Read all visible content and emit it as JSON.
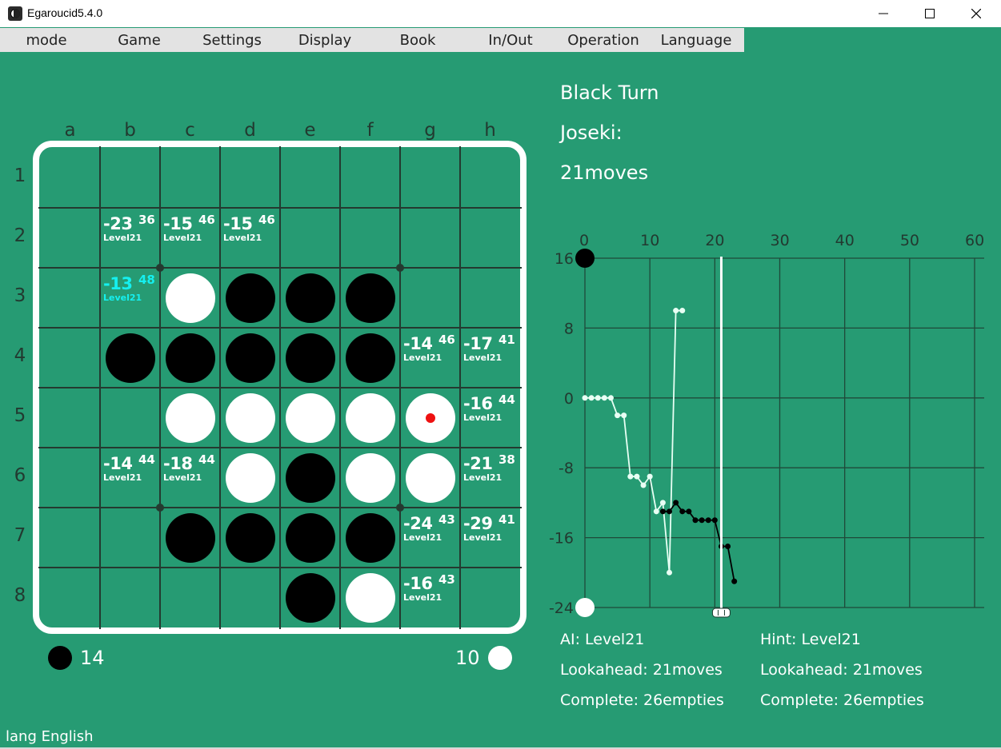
{
  "window": {
    "title": "Egaroucid5.4.0"
  },
  "menu": [
    "mode",
    "Game",
    "Settings",
    "Display",
    "Book",
    "In/Out",
    "Operation",
    "Language"
  ],
  "board": {
    "columns": [
      "a",
      "b",
      "c",
      "d",
      "e",
      "f",
      "g",
      "h"
    ],
    "rows": [
      "1",
      "2",
      "3",
      "4",
      "5",
      "6",
      "7",
      "8"
    ],
    "colors": {
      "black": "#000000",
      "white": "#ffffff",
      "best_hint": "#15f0f0",
      "legal_dot": "#ee1111"
    },
    "discs": {
      "black": [
        "d3",
        "e3",
        "f3",
        "b4",
        "c4",
        "d4",
        "e4",
        "f4",
        "e6",
        "c7",
        "d7",
        "e7",
        "f7",
        "e8"
      ],
      "white": [
        "c3",
        "c5",
        "d5",
        "e5",
        "f5",
        "g5",
        "d6",
        "f6",
        "g6",
        "f8"
      ]
    },
    "last_move_marker": "g5",
    "hints": [
      {
        "cell": "b2",
        "value": "-23",
        "sub": "36",
        "level": "Level21",
        "best": false
      },
      {
        "cell": "c2",
        "value": "-15",
        "sub": "46",
        "level": "Level21",
        "best": false
      },
      {
        "cell": "d2",
        "value": "-15",
        "sub": "46",
        "level": "Level21",
        "best": false
      },
      {
        "cell": "b3",
        "value": "-13",
        "sub": "48",
        "level": "Level21",
        "best": true
      },
      {
        "cell": "g4",
        "value": "-14",
        "sub": "46",
        "level": "Level21",
        "best": false
      },
      {
        "cell": "h4",
        "value": "-17",
        "sub": "41",
        "level": "Level21",
        "best": false
      },
      {
        "cell": "h5",
        "value": "-16",
        "sub": "44",
        "level": "Level21",
        "best": false
      },
      {
        "cell": "b6",
        "value": "-14",
        "sub": "44",
        "level": "Level21",
        "best": false
      },
      {
        "cell": "c6",
        "value": "-18",
        "sub": "44",
        "level": "Level21",
        "best": false
      },
      {
        "cell": "h6",
        "value": "-21",
        "sub": "38",
        "level": "Level21",
        "best": false
      },
      {
        "cell": "g7",
        "value": "-24",
        "sub": "43",
        "level": "Level21",
        "best": false
      },
      {
        "cell": "h7",
        "value": "-29",
        "sub": "41",
        "level": "Level21",
        "best": false
      },
      {
        "cell": "g8",
        "value": "-16",
        "sub": "43",
        "level": "Level21",
        "best": false
      }
    ]
  },
  "score": {
    "black": "14",
    "white": "10"
  },
  "info": {
    "turn": "Black Turn",
    "joseki": "Joseki:",
    "moves": "21moves"
  },
  "graph": {
    "x_ticks": [
      "0",
      "10",
      "20",
      "30",
      "40",
      "50",
      "60"
    ],
    "y_ticks": [
      "16",
      "8",
      "0",
      "-8",
      "-16",
      "-24"
    ],
    "cursor_move": 21,
    "white_series": [
      [
        0,
        0
      ],
      [
        1,
        0
      ],
      [
        2,
        0
      ],
      [
        3,
        0
      ],
      [
        4,
        0
      ],
      [
        5,
        -2
      ],
      [
        6,
        -2
      ],
      [
        7,
        -9
      ],
      [
        8,
        -9
      ],
      [
        9,
        -10
      ],
      [
        10,
        -9
      ],
      [
        11,
        -13
      ],
      [
        12,
        -12
      ],
      [
        13,
        -20
      ],
      [
        14,
        10
      ],
      [
        15,
        10
      ]
    ],
    "black_series": [
      [
        12,
        -13
      ],
      [
        13,
        -13
      ],
      [
        14,
        -12
      ],
      [
        15,
        -13
      ],
      [
        16,
        -13
      ],
      [
        17,
        -14
      ],
      [
        18,
        -14
      ],
      [
        19,
        -14
      ],
      [
        20,
        -14
      ],
      [
        21,
        -17
      ],
      [
        22,
        -17
      ],
      [
        23,
        -21
      ]
    ]
  },
  "ai_info": {
    "ai_level": "AI: Level21",
    "ai_lookahead": "Lookahead: 21moves",
    "ai_complete": "Complete: 26empties",
    "hint_level": "Hint: Level21",
    "hint_lookahead": "Lookahead: 21moves",
    "hint_complete": "Complete: 26empties"
  },
  "status": "lang English"
}
